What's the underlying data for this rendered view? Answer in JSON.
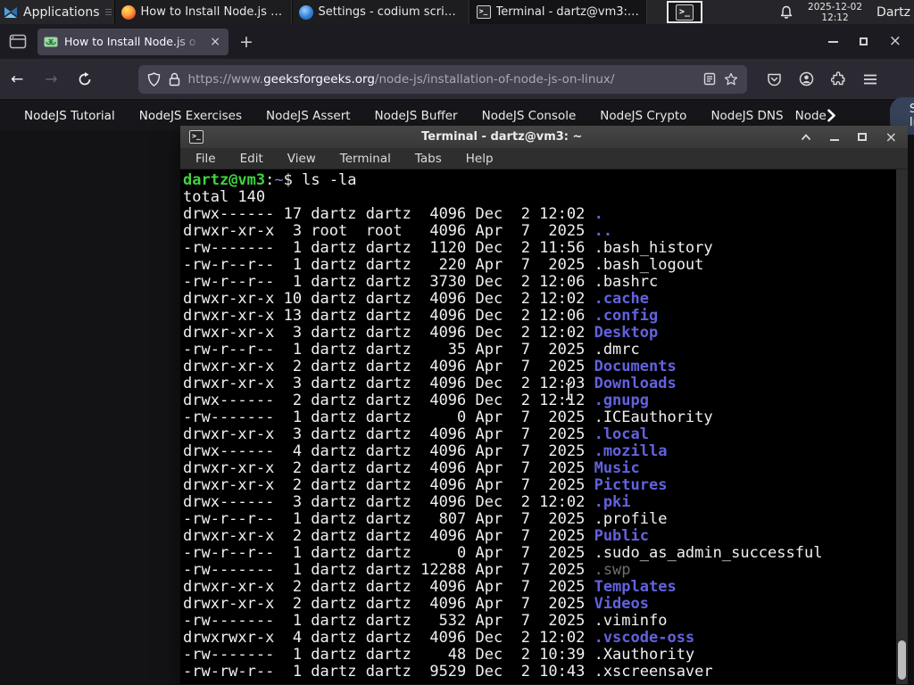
{
  "panel": {
    "applications_label": "Applications",
    "windows": [
      {
        "label": "How to Install Node.js o...",
        "icon": "firefox"
      },
      {
        "label": "Settings - codium script...",
        "icon": "codium"
      },
      {
        "label": "Terminal - dartz@vm3: ~",
        "icon": "terminal"
      }
    ],
    "clock_date": "2025-12-02",
    "clock_time": "12:12",
    "user": "Dartz"
  },
  "browser": {
    "tab_title": "How to Install Node.js o",
    "url": {
      "scheme": "https://www.",
      "domain": "geeksforgeeks.org",
      "path": "/node-js/installation-of-node-js-on-linux/"
    }
  },
  "nav": {
    "items": [
      "NodeJS Tutorial",
      "NodeJS Exercises",
      "NodeJS Assert",
      "NodeJS Buffer",
      "NodeJS Console",
      "NodeJS Crypto",
      "NodeJS DNS",
      "Node"
    ],
    "sign_in": "Sign In",
    "search_color": "#2aa55a"
  },
  "terminal": {
    "window_title": "Terminal - dartz@vm3: ~",
    "menus": [
      "File",
      "Edit",
      "View",
      "Terminal",
      "Tabs",
      "Help"
    ],
    "colors": {
      "green": "#3fd23f",
      "white": "#f0f0f0",
      "blue": "#6262de",
      "dimblue": "#8080c8",
      "gray": "#6e6e6e"
    },
    "prompt": [
      {
        "t": "dartz@vm3",
        "c": "green",
        "b": true
      },
      {
        "t": ":",
        "c": "white"
      },
      {
        "t": "~",
        "c": "dimblue"
      },
      {
        "t": "$ ",
        "c": "white"
      },
      {
        "t": "ls -la",
        "c": "white"
      }
    ],
    "total_line": "total 140",
    "lines": [
      {
        "prefix": "drwx------ 17 dartz dartz  4096 Dec  2 12:02 ",
        "name": ".",
        "color": "blue"
      },
      {
        "prefix": "drwxr-xr-x  3 root  root   4096 Apr  7  2025 ",
        "name": "..",
        "color": "blue"
      },
      {
        "prefix": "-rw-------  1 dartz dartz  1120 Dec  2 11:56 ",
        "name": ".bash_history",
        "color": "white"
      },
      {
        "prefix": "-rw-r--r--  1 dartz dartz   220 Apr  7  2025 ",
        "name": ".bash_logout",
        "color": "white"
      },
      {
        "prefix": "-rw-r--r--  1 dartz dartz  3730 Dec  2 12:06 ",
        "name": ".bashrc",
        "color": "white"
      },
      {
        "prefix": "drwxr-xr-x 10 dartz dartz  4096 Dec  2 12:02 ",
        "name": ".cache",
        "color": "blue"
      },
      {
        "prefix": "drwxr-xr-x 13 dartz dartz  4096 Dec  2 12:06 ",
        "name": ".config",
        "color": "blue"
      },
      {
        "prefix": "drwxr-xr-x  3 dartz dartz  4096 Dec  2 12:02 ",
        "name": "Desktop",
        "color": "blue"
      },
      {
        "prefix": "-rw-r--r--  1 dartz dartz    35 Apr  7  2025 ",
        "name": ".dmrc",
        "color": "white"
      },
      {
        "prefix": "drwxr-xr-x  2 dartz dartz  4096 Apr  7  2025 ",
        "name": "Documents",
        "color": "blue"
      },
      {
        "prefix": "drwxr-xr-x  3 dartz dartz  4096 Dec  2 12:03 ",
        "name": "Downloads",
        "color": "blue"
      },
      {
        "prefix": "drwx------  2 dartz dartz  4096 Dec  2 12:12 ",
        "name": ".gnupg",
        "color": "blue"
      },
      {
        "prefix": "-rw-------  1 dartz dartz     0 Apr  7  2025 ",
        "name": ".ICEauthority",
        "color": "white"
      },
      {
        "prefix": "drwxr-xr-x  3 dartz dartz  4096 Apr  7  2025 ",
        "name": ".local",
        "color": "blue"
      },
      {
        "prefix": "drwx------  4 dartz dartz  4096 Apr  7  2025 ",
        "name": ".mozilla",
        "color": "blue"
      },
      {
        "prefix": "drwxr-xr-x  2 dartz dartz  4096 Apr  7  2025 ",
        "name": "Music",
        "color": "blue"
      },
      {
        "prefix": "drwxr-xr-x  2 dartz dartz  4096 Apr  7  2025 ",
        "name": "Pictures",
        "color": "blue"
      },
      {
        "prefix": "drwx------  3 dartz dartz  4096 Dec  2 12:02 ",
        "name": ".pki",
        "color": "blue"
      },
      {
        "prefix": "-rw-r--r--  1 dartz dartz   807 Apr  7  2025 ",
        "name": ".profile",
        "color": "white"
      },
      {
        "prefix": "drwxr-xr-x  2 dartz dartz  4096 Apr  7  2025 ",
        "name": "Public",
        "color": "blue"
      },
      {
        "prefix": "-rw-r--r--  1 dartz dartz     0 Apr  7  2025 ",
        "name": ".sudo_as_admin_successful",
        "color": "white"
      },
      {
        "prefix": "-rw-------  1 dartz dartz 12288 Apr  7  2025 ",
        "name": ".swp",
        "color": "gray"
      },
      {
        "prefix": "drwxr-xr-x  2 dartz dartz  4096 Apr  7  2025 ",
        "name": "Templates",
        "color": "blue"
      },
      {
        "prefix": "drwxr-xr-x  2 dartz dartz  4096 Apr  7  2025 ",
        "name": "Videos",
        "color": "blue"
      },
      {
        "prefix": "-rw-------  1 dartz dartz   532 Apr  7  2025 ",
        "name": ".viminfo",
        "color": "white"
      },
      {
        "prefix": "drwxrwxr-x  4 dartz dartz  4096 Dec  2 12:02 ",
        "name": ".vscode-oss",
        "color": "blue"
      },
      {
        "prefix": "-rw-------  1 dartz dartz    48 Dec  2 10:39 ",
        "name": ".Xauthority",
        "color": "white"
      },
      {
        "prefix": "-rw-rw-r--  1 dartz dartz  9529 Dec  2 10:43 ",
        "name": ".xscreensaver",
        "color": "white"
      }
    ]
  }
}
